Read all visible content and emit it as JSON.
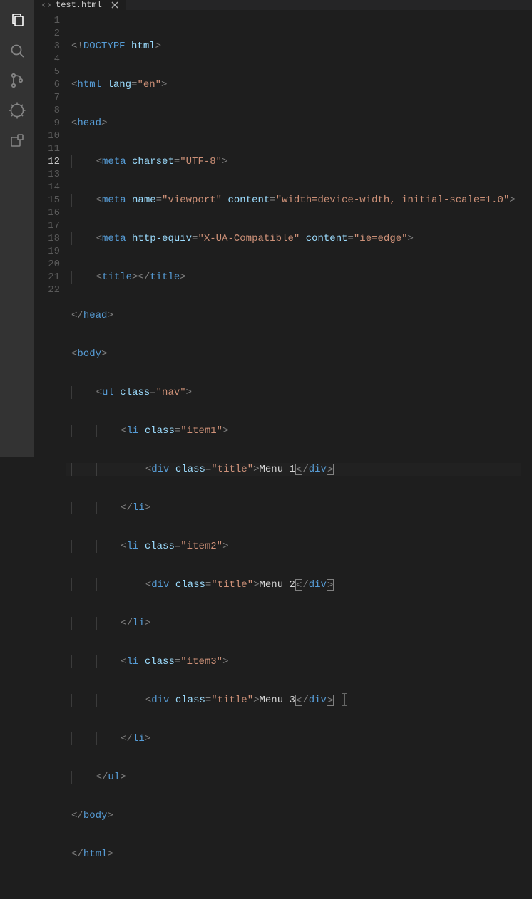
{
  "activityBar": {
    "items": [
      {
        "name": "explorer-icon",
        "active": true
      },
      {
        "name": "search-icon",
        "active": false
      },
      {
        "name": "source-control-icon",
        "active": false
      },
      {
        "name": "debug-icon",
        "active": false
      },
      {
        "name": "extensions-icon",
        "active": false
      }
    ]
  },
  "tab": {
    "filename": "test.html"
  },
  "gutter": {
    "lineCount": 22,
    "currentLine": 12
  },
  "code": {
    "l1": {
      "p1": "<!",
      "doctype": "DOCTYPE",
      "sp": " ",
      "html": "html",
      "p2": ">"
    },
    "l2": {
      "p1": "<",
      "tag": "html",
      "sp": " ",
      "attr": "lang",
      "eq": "=",
      "val": "\"en\"",
      "p2": ">"
    },
    "l3": {
      "p1": "<",
      "tag": "head",
      "p2": ">"
    },
    "l4": {
      "p1": "<",
      "tag": "meta",
      "sp": " ",
      "attr": "charset",
      "eq": "=",
      "val": "\"UTF-8\"",
      "p2": ">"
    },
    "l5": {
      "p1": "<",
      "tag": "meta",
      "sp": " ",
      "attr1": "name",
      "eq": "=",
      "val1": "\"viewport\"",
      "sp2": " ",
      "attr2": "content",
      "val2": "\"width=device-width, initial-scale=1.0\"",
      "p2": ">"
    },
    "l6": {
      "p1": "<",
      "tag": "meta",
      "sp": " ",
      "attr1": "http-equiv",
      "eq": "=",
      "val1": "\"X-UA-Compatible\"",
      "sp2": " ",
      "attr2": "content",
      "val2": "\"ie=edge\"",
      "p2": ">"
    },
    "l7": {
      "p1": "<",
      "tag": "title",
      "p2": "></",
      "tagc": "title",
      "p3": ">"
    },
    "l8": {
      "p1": "</",
      "tag": "head",
      "p2": ">"
    },
    "l9": {
      "p1": "<",
      "tag": "body",
      "p2": ">"
    },
    "l10": {
      "p1": "<",
      "tag": "ul",
      "sp": " ",
      "attr": "class",
      "eq": "=",
      "val": "\"nav\"",
      "p2": ">"
    },
    "l11": {
      "p1": "<",
      "tag": "li",
      "sp": " ",
      "attr": "class",
      "eq": "=",
      "val": "\"item1\"",
      "p2": ">"
    },
    "l12": {
      "p1": "<",
      "tag": "div",
      "sp": " ",
      "attr": "class",
      "eq": "=",
      "val": "\"title\"",
      "p2": ">",
      "text": "Menu 1",
      "c1": "<",
      "c2": "/",
      "ctag": "div",
      "c3": ">"
    },
    "l13": {
      "p1": "</",
      "tag": "li",
      "p2": ">"
    },
    "l14": {
      "p1": "<",
      "tag": "li",
      "sp": " ",
      "attr": "class",
      "eq": "=",
      "val": "\"item2\"",
      "p2": ">"
    },
    "l15": {
      "p1": "<",
      "tag": "div",
      "sp": " ",
      "attr": "class",
      "eq": "=",
      "val": "\"title\"",
      "p2": ">",
      "text": "Menu 2",
      "c1": "<",
      "c2": "/",
      "ctag": "div",
      "c3": ">"
    },
    "l16": {
      "p1": "</",
      "tag": "li",
      "p2": ">"
    },
    "l17": {
      "p1": "<",
      "tag": "li",
      "sp": " ",
      "attr": "class",
      "eq": "=",
      "val": "\"item3\"",
      "p2": ">"
    },
    "l18": {
      "p1": "<",
      "tag": "div",
      "sp": " ",
      "attr": "class",
      "eq": "=",
      "val": "\"title\"",
      "p2": ">",
      "text": "Menu 3",
      "c1": "<",
      "c2": "/",
      "ctag": "div",
      "c3": ">"
    },
    "l19": {
      "p1": "</",
      "tag": "li",
      "p2": ">"
    },
    "l20": {
      "p1": "</",
      "tag": "ul",
      "p2": ">"
    },
    "l21": {
      "p1": "</",
      "tag": "body",
      "p2": ">"
    },
    "l22": {
      "p1": "</",
      "tag": "html",
      "p2": ">"
    }
  }
}
